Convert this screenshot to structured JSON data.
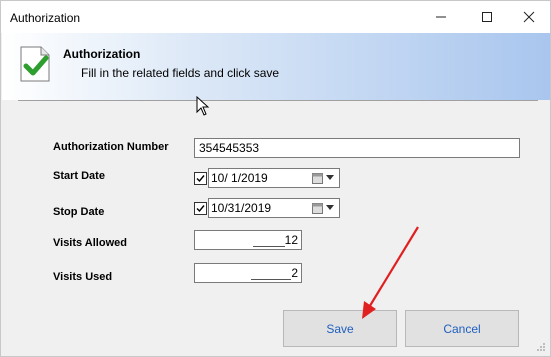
{
  "window": {
    "title": "Authorization",
    "controls": {
      "minimize": "─",
      "maximize": "☐",
      "close": "✕"
    }
  },
  "header": {
    "title": "Authorization",
    "subtitle": "Fill in the related fields and click save",
    "icon": "document-check-icon"
  },
  "form": {
    "authorization_number": {
      "label": "Authorization Number",
      "value": "354545353"
    },
    "start_date": {
      "label": "Start Date",
      "checked": true,
      "value": "10/  1/2019"
    },
    "stop_date": {
      "label": "Stop Date",
      "checked": true,
      "value": "10/31/2019"
    },
    "visits_allowed": {
      "label": "Visits Allowed",
      "value": "12"
    },
    "visits_used": {
      "label": "Visits Used",
      "value": "2"
    }
  },
  "buttons": {
    "save": "Save",
    "cancel": "Cancel"
  },
  "colors": {
    "accent_text": "#1f5fbf",
    "annotation_arrow": "#e02020",
    "check_green": "#2e9e2e"
  }
}
